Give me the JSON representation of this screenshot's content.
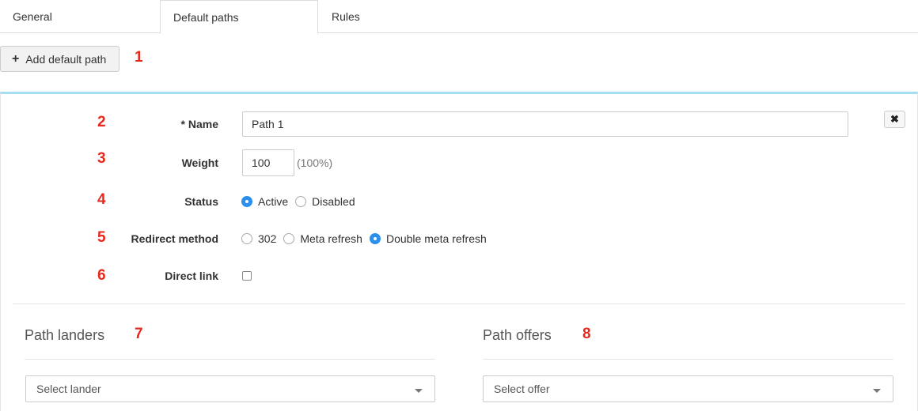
{
  "tabs": [
    {
      "label": "General"
    },
    {
      "label": "Default paths"
    },
    {
      "label": "Rules"
    }
  ],
  "add_button": {
    "label": "Add default path",
    "icon": "plus-icon"
  },
  "annotations": [
    "1",
    "2",
    "3",
    "4",
    "5",
    "6",
    "7",
    "8"
  ],
  "form": {
    "close_icon": "close-icon",
    "close_glyph": "✖",
    "name": {
      "label": "* Name",
      "value": "Path 1"
    },
    "weight": {
      "label": "Weight",
      "value": "100",
      "percent": "(100%)"
    },
    "status": {
      "label": "Status",
      "options": [
        "Active",
        "Disabled"
      ],
      "selected": "Active"
    },
    "redirect": {
      "label": "Redirect method",
      "options": [
        "302",
        "Meta refresh",
        "Double meta refresh"
      ],
      "selected": "Double meta refresh"
    },
    "direct_link": {
      "label": "Direct link",
      "checked": false
    }
  },
  "landers": {
    "title": "Path landers",
    "placeholder": "Select lander"
  },
  "offers": {
    "title": "Path offers",
    "placeholder": "Select offer"
  },
  "colors": {
    "accent": "#2b8fec",
    "panel_top_border": "#a6dff4",
    "annotation": "#e8281c"
  }
}
